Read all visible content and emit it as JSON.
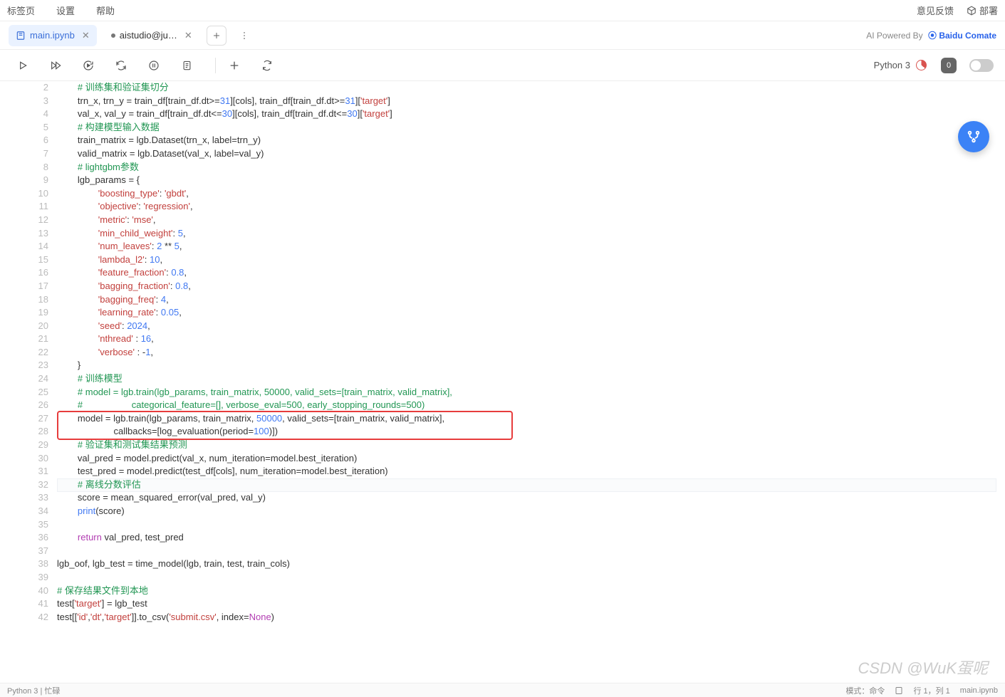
{
  "menu": {
    "tabs": "标签页",
    "settings": "设置",
    "help": "帮助",
    "feedback": "意见反馈",
    "deploy": "部署"
  },
  "tabs": {
    "main": "main.ipynb",
    "other": "aistudio@ju…",
    "powered_prefix": "AI Powered By ",
    "powered_brand": "Baidu Comate"
  },
  "toolbar": {
    "kernel": "Python 3",
    "badge": "0"
  },
  "statusbar": {
    "left": "Python 3 | 忙碌",
    "mode": "模式：命令",
    "ln": "行 1，列 1",
    "file": "main.ipynb"
  },
  "watermark": "CSDN @WuK蛋呢",
  "highlight_index": 30,
  "redbox": {
    "start": 25,
    "end": 26
  },
  "code": [
    {
      "n": 2,
      "indent": 2,
      "tokens": [
        [
          "comment",
          "# 训练集和验证集切分"
        ]
      ]
    },
    {
      "n": 3,
      "indent": 2,
      "tokens": [
        [
          "plain",
          "trn_x, trn_y = train_df[train_df.dt>="
        ],
        [
          "num",
          "31"
        ],
        [
          "plain",
          "][cols], train_df[train_df.dt>="
        ],
        [
          "num",
          "31"
        ],
        [
          "plain",
          "]["
        ],
        [
          "str",
          "'target'"
        ],
        [
          "plain",
          "]"
        ]
      ]
    },
    {
      "n": 4,
      "indent": 2,
      "tokens": [
        [
          "plain",
          "val_x, val_y = train_df[train_df.dt<="
        ],
        [
          "num",
          "30"
        ],
        [
          "plain",
          "][cols], train_df[train_df.dt<="
        ],
        [
          "num",
          "30"
        ],
        [
          "plain",
          "]["
        ],
        [
          "str",
          "'target'"
        ],
        [
          "plain",
          "]"
        ]
      ]
    },
    {
      "n": 5,
      "indent": 2,
      "tokens": [
        [
          "comment",
          "# 构建模型输入数据"
        ]
      ]
    },
    {
      "n": 6,
      "indent": 2,
      "tokens": [
        [
          "plain",
          "train_matrix = lgb.Dataset(trn_x, label=trn_y)"
        ]
      ]
    },
    {
      "n": 7,
      "indent": 2,
      "tokens": [
        [
          "plain",
          "valid_matrix = lgb.Dataset(val_x, label=val_y)"
        ]
      ]
    },
    {
      "n": 8,
      "indent": 2,
      "tokens": [
        [
          "comment",
          "# lightgbm参数"
        ]
      ]
    },
    {
      "n": 9,
      "indent": 2,
      "tokens": [
        [
          "plain",
          "lgb_params = {"
        ]
      ]
    },
    {
      "n": 10,
      "indent": 4,
      "tokens": [
        [
          "str",
          "'boosting_type'"
        ],
        [
          "plain",
          ": "
        ],
        [
          "str",
          "'gbdt'"
        ],
        [
          "plain",
          ","
        ]
      ]
    },
    {
      "n": 11,
      "indent": 4,
      "tokens": [
        [
          "str",
          "'objective'"
        ],
        [
          "plain",
          ": "
        ],
        [
          "str",
          "'regression'"
        ],
        [
          "plain",
          ","
        ]
      ]
    },
    {
      "n": 12,
      "indent": 4,
      "tokens": [
        [
          "str",
          "'metric'"
        ],
        [
          "plain",
          ": "
        ],
        [
          "str",
          "'mse'"
        ],
        [
          "plain",
          ","
        ]
      ]
    },
    {
      "n": 13,
      "indent": 4,
      "tokens": [
        [
          "str",
          "'min_child_weight'"
        ],
        [
          "plain",
          ": "
        ],
        [
          "num",
          "5"
        ],
        [
          "plain",
          ","
        ]
      ]
    },
    {
      "n": 14,
      "indent": 4,
      "tokens": [
        [
          "str",
          "'num_leaves'"
        ],
        [
          "plain",
          ": "
        ],
        [
          "num",
          "2"
        ],
        [
          "plain",
          " ** "
        ],
        [
          "num",
          "5"
        ],
        [
          "plain",
          ","
        ]
      ]
    },
    {
      "n": 15,
      "indent": 4,
      "tokens": [
        [
          "str",
          "'lambda_l2'"
        ],
        [
          "plain",
          ": "
        ],
        [
          "num",
          "10"
        ],
        [
          "plain",
          ","
        ]
      ]
    },
    {
      "n": 16,
      "indent": 4,
      "tokens": [
        [
          "str",
          "'feature_fraction'"
        ],
        [
          "plain",
          ": "
        ],
        [
          "num",
          "0.8"
        ],
        [
          "plain",
          ","
        ]
      ]
    },
    {
      "n": 17,
      "indent": 4,
      "tokens": [
        [
          "str",
          "'bagging_fraction'"
        ],
        [
          "plain",
          ": "
        ],
        [
          "num",
          "0.8"
        ],
        [
          "plain",
          ","
        ]
      ]
    },
    {
      "n": 18,
      "indent": 4,
      "tokens": [
        [
          "str",
          "'bagging_freq'"
        ],
        [
          "plain",
          ": "
        ],
        [
          "num",
          "4"
        ],
        [
          "plain",
          ","
        ]
      ]
    },
    {
      "n": 19,
      "indent": 4,
      "tokens": [
        [
          "str",
          "'learning_rate'"
        ],
        [
          "plain",
          ": "
        ],
        [
          "num",
          "0.05"
        ],
        [
          "plain",
          ","
        ]
      ]
    },
    {
      "n": 20,
      "indent": 4,
      "tokens": [
        [
          "str",
          "'seed'"
        ],
        [
          "plain",
          ": "
        ],
        [
          "num",
          "2024"
        ],
        [
          "plain",
          ","
        ]
      ]
    },
    {
      "n": 21,
      "indent": 4,
      "tokens": [
        [
          "str",
          "'nthread'"
        ],
        [
          "plain",
          " : "
        ],
        [
          "num",
          "16"
        ],
        [
          "plain",
          ","
        ]
      ]
    },
    {
      "n": 22,
      "indent": 4,
      "tokens": [
        [
          "str",
          "'verbose'"
        ],
        [
          "plain",
          " : -"
        ],
        [
          "num",
          "1"
        ],
        [
          "plain",
          ","
        ]
      ]
    },
    {
      "n": 23,
      "indent": 2,
      "tokens": [
        [
          "plain",
          "}"
        ]
      ]
    },
    {
      "n": 24,
      "indent": 2,
      "tokens": [
        [
          "comment",
          "# 训练模型"
        ]
      ]
    },
    {
      "n": 25,
      "indent": 2,
      "tokens": [
        [
          "comment",
          "# model = lgb.train(lgb_params, train_matrix, 50000, valid_sets=[train_matrix, valid_matrix],"
        ]
      ]
    },
    {
      "n": 26,
      "indent": 2,
      "tokens": [
        [
          "comment",
          "#                   categorical_feature=[], verbose_eval=500, early_stopping_rounds=500)"
        ]
      ]
    },
    {
      "n": 27,
      "indent": 2,
      "tokens": [
        [
          "plain",
          "model = lgb.train(lgb_params, train_matrix, "
        ],
        [
          "num",
          "50000"
        ],
        [
          "plain",
          ", valid_sets=[train_matrix, valid_matrix],"
        ]
      ]
    },
    {
      "n": 28,
      "indent": 2,
      "tokens": [
        [
          "plain",
          "              callbacks=[log_evaluation(period="
        ],
        [
          "num",
          "100"
        ],
        [
          "plain",
          ")])"
        ]
      ]
    },
    {
      "n": 29,
      "indent": 2,
      "tokens": [
        [
          "comment",
          "# 验证集和测试集结果预测"
        ]
      ]
    },
    {
      "n": 30,
      "indent": 2,
      "tokens": [
        [
          "plain",
          "val_pred = model.predict(val_x, num_iteration=model.best_iteration)"
        ]
      ]
    },
    {
      "n": 31,
      "indent": 2,
      "tokens": [
        [
          "plain",
          "test_pred = model.predict(test_df[cols], num_iteration=model.best_iteration)"
        ]
      ]
    },
    {
      "n": 32,
      "indent": 2,
      "tokens": [
        [
          "comment",
          "# 离线分数评估"
        ]
      ]
    },
    {
      "n": 33,
      "indent": 2,
      "tokens": [
        [
          "plain",
          "score = mean_squared_error(val_pred, val_y)"
        ]
      ]
    },
    {
      "n": 34,
      "indent": 2,
      "tokens": [
        [
          "builtin",
          "print"
        ],
        [
          "plain",
          "(score)"
        ]
      ]
    },
    {
      "n": 35,
      "indent": 2,
      "tokens": [
        [
          "plain",
          ""
        ]
      ]
    },
    {
      "n": 36,
      "indent": 2,
      "tokens": [
        [
          "kw",
          "return"
        ],
        [
          "plain",
          " val_pred, test_pred"
        ]
      ]
    },
    {
      "n": 37,
      "indent": 0,
      "tokens": [
        [
          "plain",
          ""
        ]
      ]
    },
    {
      "n": 38,
      "indent": 0,
      "tokens": [
        [
          "plain",
          "lgb_oof, lgb_test = time_model(lgb, train, test, train_cols)"
        ]
      ]
    },
    {
      "n": 39,
      "indent": 0,
      "tokens": [
        [
          "plain",
          ""
        ]
      ]
    },
    {
      "n": 40,
      "indent": 0,
      "tokens": [
        [
          "comment",
          "# 保存结果文件到本地"
        ]
      ]
    },
    {
      "n": 41,
      "indent": 0,
      "tokens": [
        [
          "plain",
          "test["
        ],
        [
          "str",
          "'target'"
        ],
        [
          "plain",
          "] = lgb_test"
        ]
      ]
    },
    {
      "n": 42,
      "indent": 0,
      "tokens": [
        [
          "plain",
          "test[["
        ],
        [
          "str",
          "'id'"
        ],
        [
          "plain",
          ","
        ],
        [
          "str",
          "'dt'"
        ],
        [
          "plain",
          ","
        ],
        [
          "str",
          "'target'"
        ],
        [
          "plain",
          "]].to_csv("
        ],
        [
          "str",
          "'submit.csv'"
        ],
        [
          "plain",
          ", index="
        ],
        [
          "kw",
          "None"
        ],
        [
          "plain",
          ")"
        ]
      ]
    }
  ]
}
